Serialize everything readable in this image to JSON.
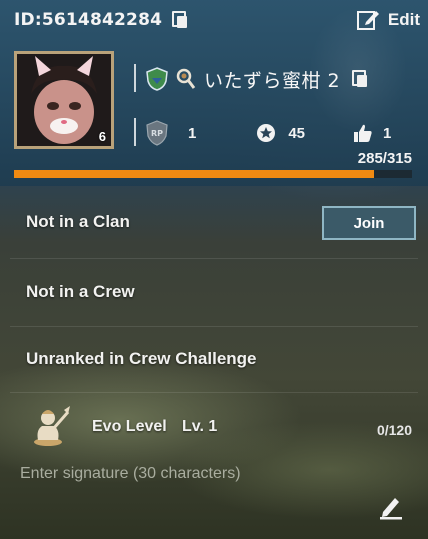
{
  "profile": {
    "id_text": "ID:5614842284",
    "edit_label": "Edit",
    "player_name": "いたずら蜜柑 2",
    "avatar_level": "6"
  },
  "stats": {
    "rp_value": "1",
    "star_value": "45",
    "likes_value": "1"
  },
  "xp": {
    "text": "285/315",
    "current": 285,
    "max": 315,
    "bar_color": "#f08a12"
  },
  "clan": {
    "label": "Not in a Clan",
    "join_label": "Join"
  },
  "crew": {
    "label": "Not in a Crew"
  },
  "crew_challenge": {
    "label": "Unranked in Crew Challenge"
  },
  "evo": {
    "label": "Evo Level",
    "level": "Lv. 1",
    "progress": "0/120"
  },
  "signature": {
    "placeholder": "Enter signature (30 characters)",
    "value": ""
  },
  "icons": {
    "copy": "copy-icon",
    "edit": "edit-icon",
    "emblem": "shield-emblem-icon",
    "key": "key-icon",
    "rp": "rp-badge-icon",
    "star": "star-icon",
    "thumb": "thumbs-up-icon",
    "evo": "evo-character-icon",
    "pencil": "pencil-icon"
  }
}
